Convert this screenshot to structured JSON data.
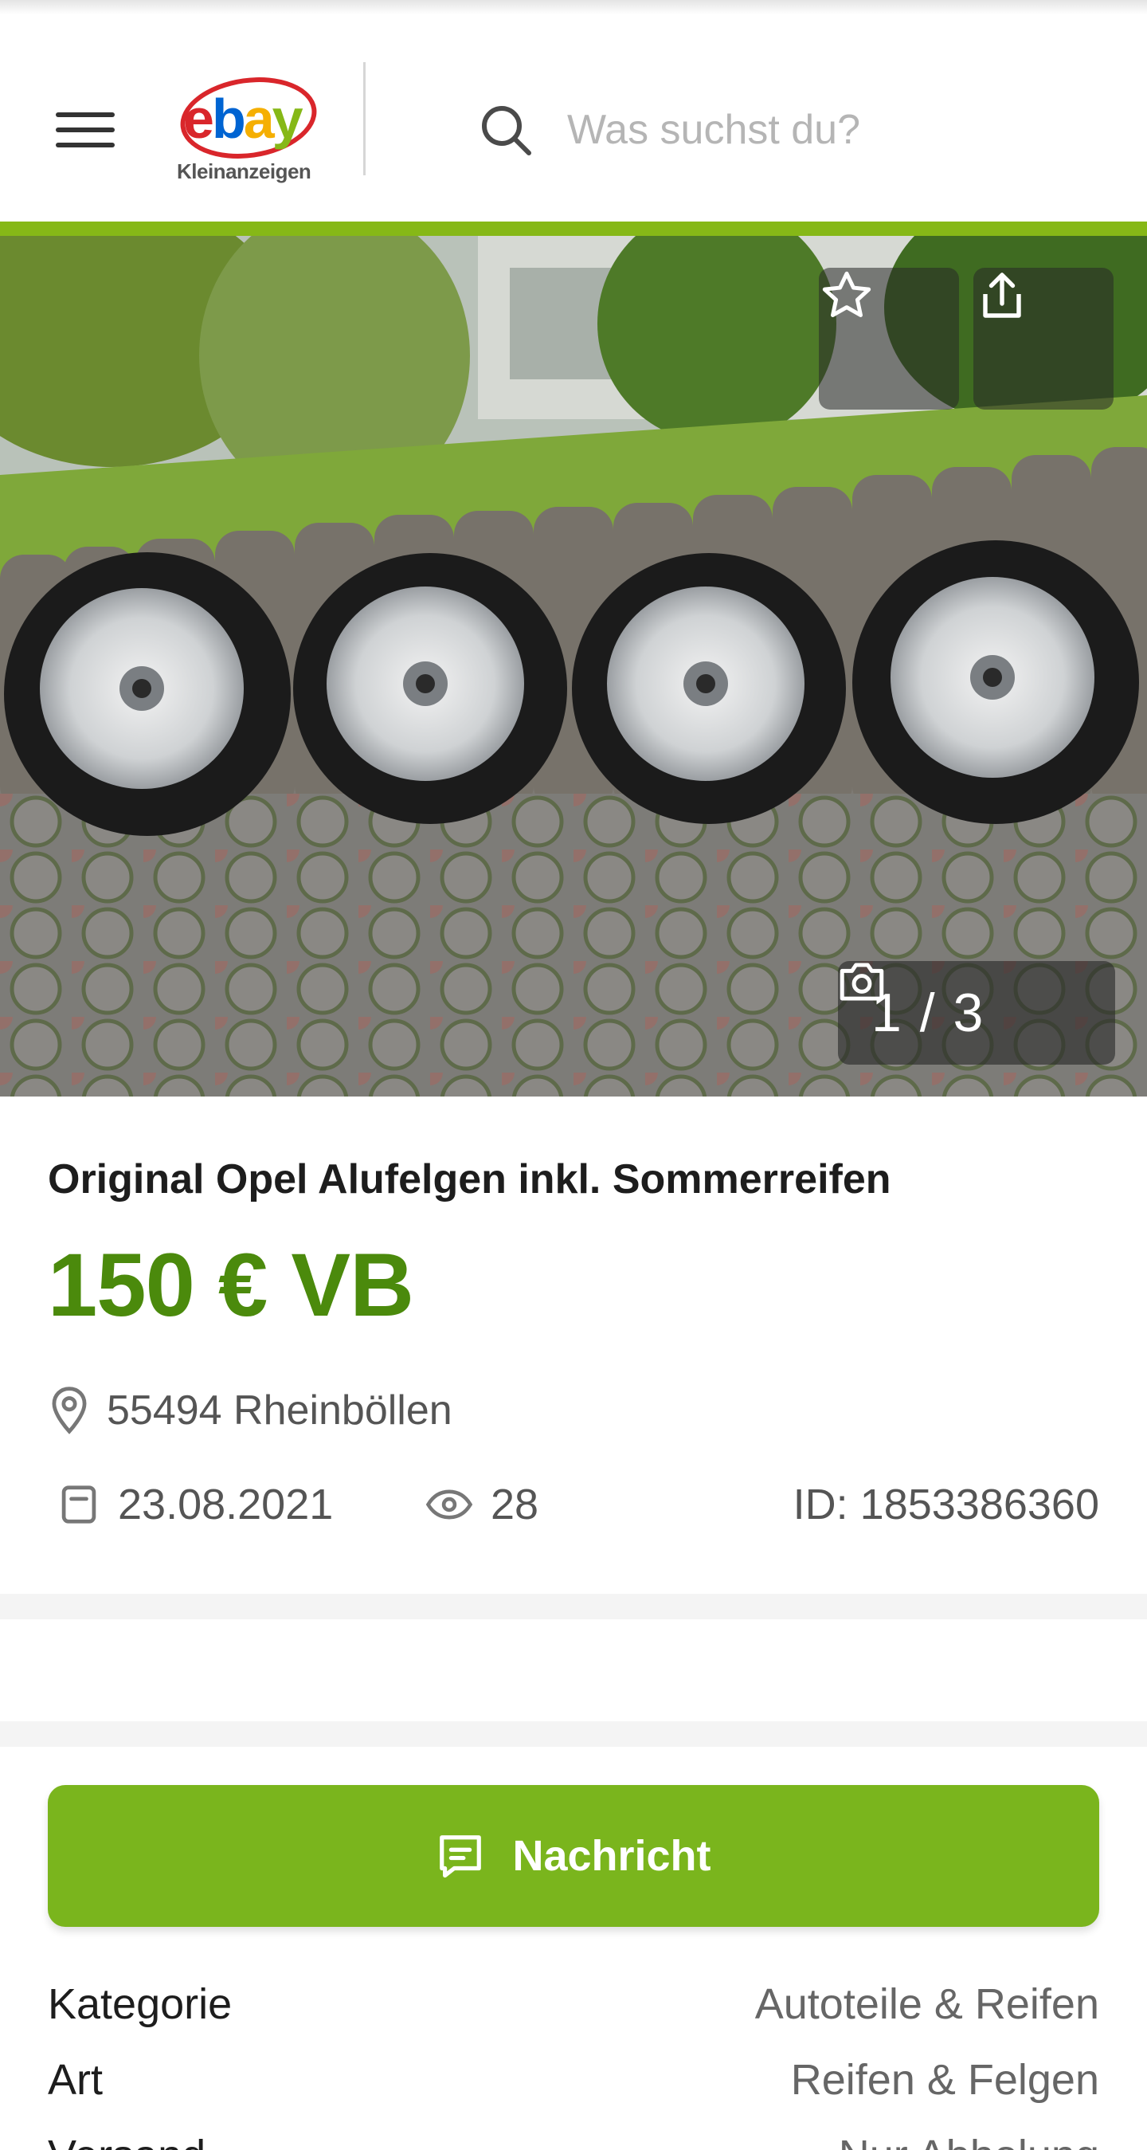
{
  "header": {
    "logo_brand": "ebay",
    "logo_subtitle": "Kleinanzeigen",
    "search_placeholder": "Was suchst du?"
  },
  "gallery": {
    "counter": "1 / 3",
    "icons": [
      "favorite-star-icon",
      "share-icon",
      "camera-icon"
    ]
  },
  "listing": {
    "title": "Original Opel Alufelgen inkl. Sommerreifen",
    "price": "150 € VB",
    "location": "55494 Rheinböllen",
    "date": "23.08.2021",
    "views": "28",
    "id": "ID: 1853386360"
  },
  "actions": {
    "message_label": "Nachricht"
  },
  "details": [
    {
      "key": "Kategorie",
      "value": "Autoteile & Reifen"
    },
    {
      "key": "Art",
      "value": "Reifen & Felgen"
    },
    {
      "key": "Versand",
      "value": "Nur Abholung"
    }
  ],
  "colors": {
    "accent_green": "#86b817",
    "price_green": "#4b8a0c",
    "button_green": "#7ab51d"
  }
}
